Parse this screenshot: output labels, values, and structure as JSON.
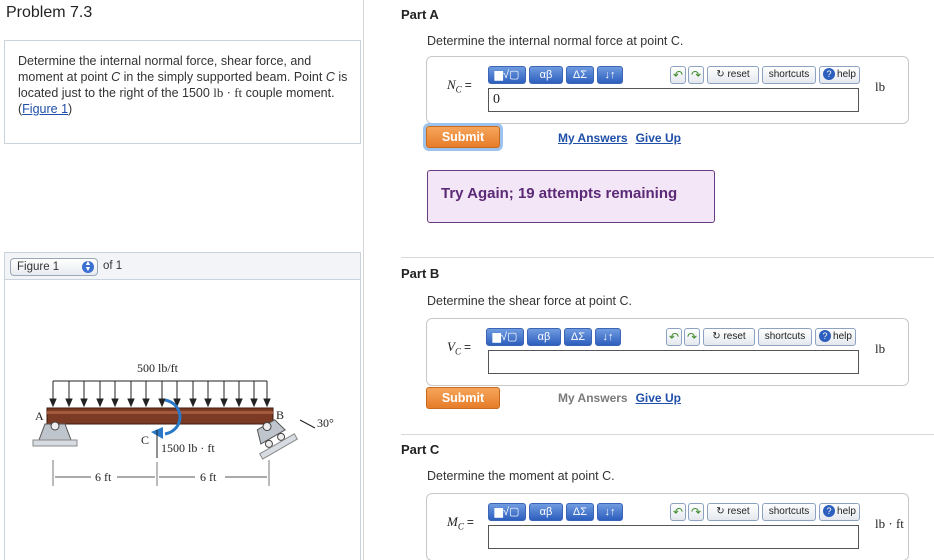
{
  "problem": {
    "title": "Problem 7.3",
    "text_1": "Determine the internal normal force, shear force, and moment at point ",
    "point": "C",
    "text_2": " in the simply supported beam. Point ",
    "text_3": " is located just to the right of the 1500 ",
    "unit": "lb · ft",
    "text_4": " couple moment.(",
    "figure_link": "Figure 1",
    "text_5": ")"
  },
  "figure": {
    "select_label": "Figure 1",
    "of_label": "of 1",
    "labels": {
      "load": "500 lb/ft",
      "point_a": "A",
      "point_b": "B",
      "point_c": "C",
      "moment": "1500 lb · ft",
      "angle": "30°",
      "dim_left": "6 ft",
      "dim_right": "6 ft"
    }
  },
  "toolbar": {
    "templates": "▆√▢",
    "greek": "αβ",
    "sum": "ΔΣ",
    "arrows": "↓↑",
    "undo": "↶",
    "redo": "↷",
    "reset": "↻ reset",
    "shortcuts": "shortcuts",
    "help_icon": "?",
    "help": "help"
  },
  "parts": [
    {
      "title": "Part A",
      "question": "Determine the internal normal force at point C.",
      "var": "N",
      "sub": "C",
      "eq": "=",
      "value": "0",
      "unit": "lb",
      "submit": "Submit",
      "my_answers": "My Answers",
      "give_up": "Give Up"
    },
    {
      "title": "Part B",
      "question": "Determine the shear force at point C.",
      "var": "V",
      "sub": "C",
      "eq": "=",
      "value": "",
      "unit": "lb",
      "submit": "Submit",
      "my_answers": "My Answers",
      "give_up": "Give Up"
    },
    {
      "title": "Part C",
      "question": "Determine the moment at point C.",
      "var": "M",
      "sub": "C",
      "eq": "=",
      "value": "",
      "unit": "lb · ft"
    }
  ],
  "feedback": {
    "try_again": "Try Again; 19 attempts remaining"
  }
}
